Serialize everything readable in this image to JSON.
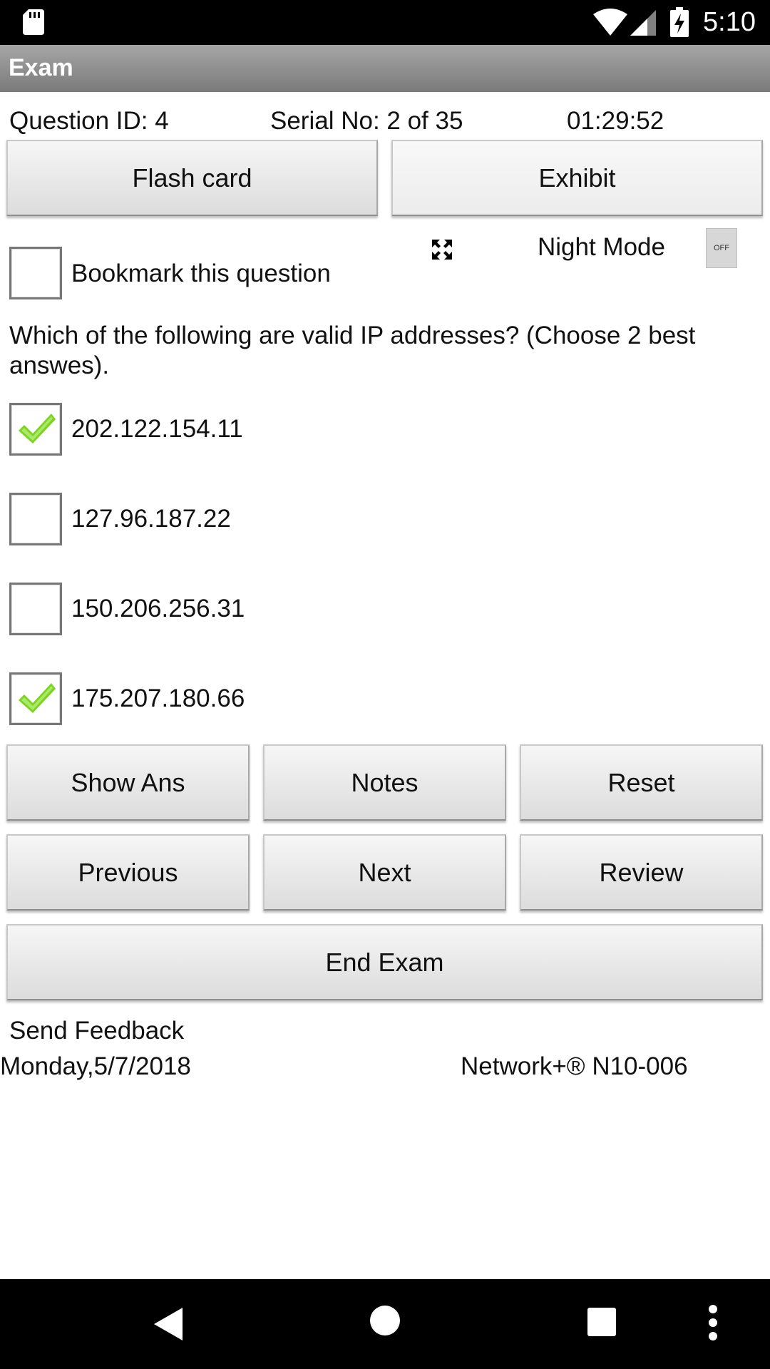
{
  "status_bar": {
    "time": "5:10"
  },
  "title_bar": {
    "title": "Exam"
  },
  "info": {
    "question_id": "Question ID: 4",
    "serial": "Serial No: 2 of 35",
    "timer": "01:29:52"
  },
  "top_buttons": {
    "flash_card": "Flash card",
    "exhibit": "Exhibit"
  },
  "night_mode": {
    "label": "Night Mode",
    "toggle_text": "OFF"
  },
  "bookmark": {
    "label": "Bookmark this question",
    "checked": false
  },
  "question": {
    "text": "Which of the following are valid IP addresses? (Choose 2 best answes).",
    "options": [
      {
        "label": "202.122.154.11",
        "checked": true
      },
      {
        "label": "127.96.187.22",
        "checked": false
      },
      {
        "label": "150.206.256.31",
        "checked": false
      },
      {
        "label": "175.207.180.66",
        "checked": true
      }
    ]
  },
  "actions": {
    "show_ans": "Show Ans",
    "notes": "Notes",
    "reset": "Reset",
    "previous": "Previous",
    "next": "Next",
    "review": "Review",
    "end_exam": "End Exam"
  },
  "footer": {
    "send_feedback": "Send Feedback",
    "date": "Monday,5/7/2018",
    "exam_name": "Network+®  N10-006"
  },
  "colors": {
    "check_green": "#7ed321",
    "title_bar": "#8c8c8c"
  }
}
